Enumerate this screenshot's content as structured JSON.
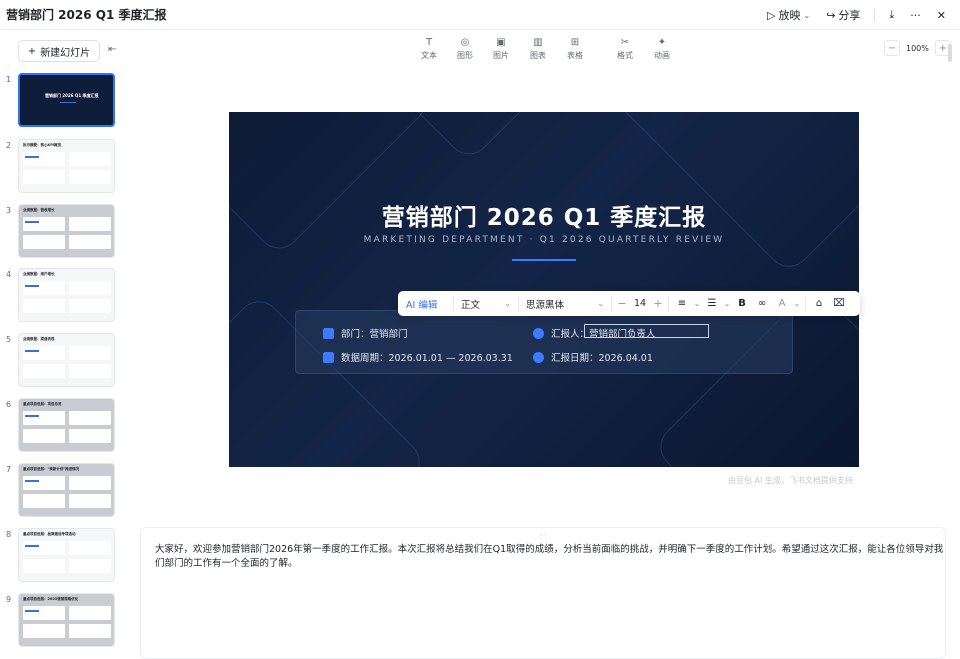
{
  "app": {
    "title": "营销部门 2026 Q1 季度汇报",
    "present_label": "放映",
    "share_label": "分享",
    "more_label": "···",
    "close_label": "✕"
  },
  "sidebar": {
    "new_slide_label": "新建幻灯片",
    "collapse_label": "⇤",
    "thumbnails": [
      {
        "num": "1",
        "title": "营销部门 2026 Q1 季度汇报",
        "style": "dark",
        "active": true
      },
      {
        "num": "2",
        "title": "执行摘要：核心KPI概览",
        "style": "light",
        "active": false
      },
      {
        "num": "3",
        "title": "业绩数据：营收增长",
        "style": "gray",
        "active": false
      },
      {
        "num": "4",
        "title": "业绩数据：用户增长",
        "style": "light",
        "active": false
      },
      {
        "num": "5",
        "title": "业绩数据：渠道表现",
        "style": "light",
        "active": false
      },
      {
        "num": "6",
        "title": "重点项目进展：项目总览",
        "style": "gray",
        "active": false
      },
      {
        "num": "7",
        "title": "重点项目进展：\"焕新计划\"推进情况",
        "style": "gray",
        "active": false
      },
      {
        "num": "8",
        "title": "重点项目进展：品牌建设专项活动",
        "style": "light",
        "active": false
      },
      {
        "num": "9",
        "title": "重点项目进展：2025营销策略优化",
        "style": "gray",
        "active": false
      }
    ]
  },
  "toolbar": {
    "items": [
      {
        "icon": "text-icon",
        "glyph": "T",
        "label": "文本"
      },
      {
        "icon": "shape-icon",
        "glyph": "◎",
        "label": "图形"
      },
      {
        "icon": "image-icon",
        "glyph": "▣",
        "label": "图片"
      },
      {
        "icon": "chart-icon",
        "glyph": "▥",
        "label": "图表"
      },
      {
        "icon": "table-icon",
        "glyph": "⊞",
        "label": "表格"
      },
      {
        "icon": "format-icon",
        "glyph": "✂",
        "label": "格式"
      },
      {
        "icon": "animation-icon",
        "glyph": "✦",
        "label": "动画"
      }
    ],
    "zoom_minus": "−",
    "zoom_value": "100%",
    "zoom_plus": "+"
  },
  "slide": {
    "title": "营销部门 2026 Q1 季度汇报",
    "subtitle": "MARKETING DEPARTMENT · Q1 2026 QUARTERLY REVIEW",
    "department": "部门：营销部门",
    "period": "数据周期：2026.01.01 — 2026.03.31",
    "reporter": "汇报人：营销部门负责人",
    "report_date": "汇报日期：2026.04.01",
    "accent_color": "#3c7bff"
  },
  "ai_toolbar": {
    "ai_label": "AI 编辑",
    "style_value": "正文",
    "font_value": "思源黑体",
    "font_size": "14",
    "minus": "−",
    "plus": "+",
    "bold": "B"
  },
  "watermark": "由豆包 AI 生成，飞书文档提供支持",
  "notes": {
    "text": "大家好，欢迎参加营销部门2026年第一季度的工作汇报。本次汇报将总结我们在Q1取得的成绩，分析当前面临的挑战，并明确下一季度的工作计划。希望通过这次汇报，能让各位领导对我们部门的工作有一个全面的了解。"
  }
}
